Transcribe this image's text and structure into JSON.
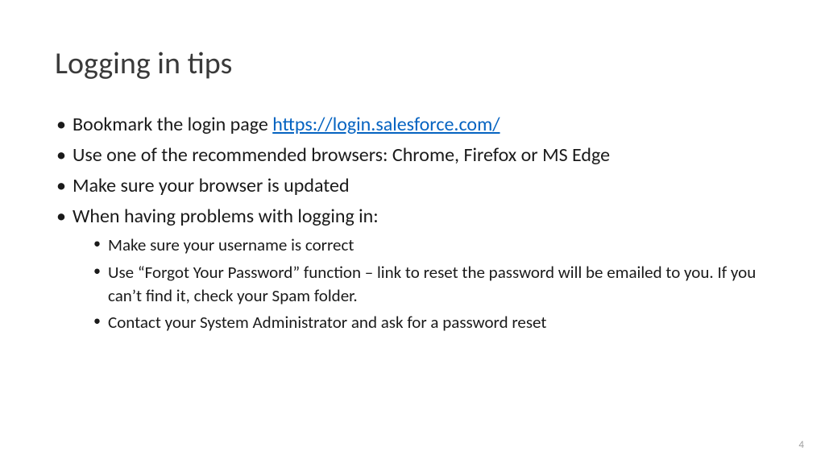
{
  "title": "Logging in tips",
  "bullets": {
    "b1_prefix": "Bookmark the login page ",
    "b1_link": "https://login.salesforce.com/",
    "b2": "Use one of the recommended browsers: Chrome, Firefox or MS Edge",
    "b3": "Make sure your browser is updated",
    "b4": "When having problems with logging in:",
    "sub": {
      "s1": "Make sure your username is correct",
      "s2": "Use “Forgot Your Password” function – link to reset the password will be emailed to you. If you can’t find it, check your Spam folder.",
      "s3": "Contact your System Administrator and ask for a password reset"
    }
  },
  "page_number": "4"
}
